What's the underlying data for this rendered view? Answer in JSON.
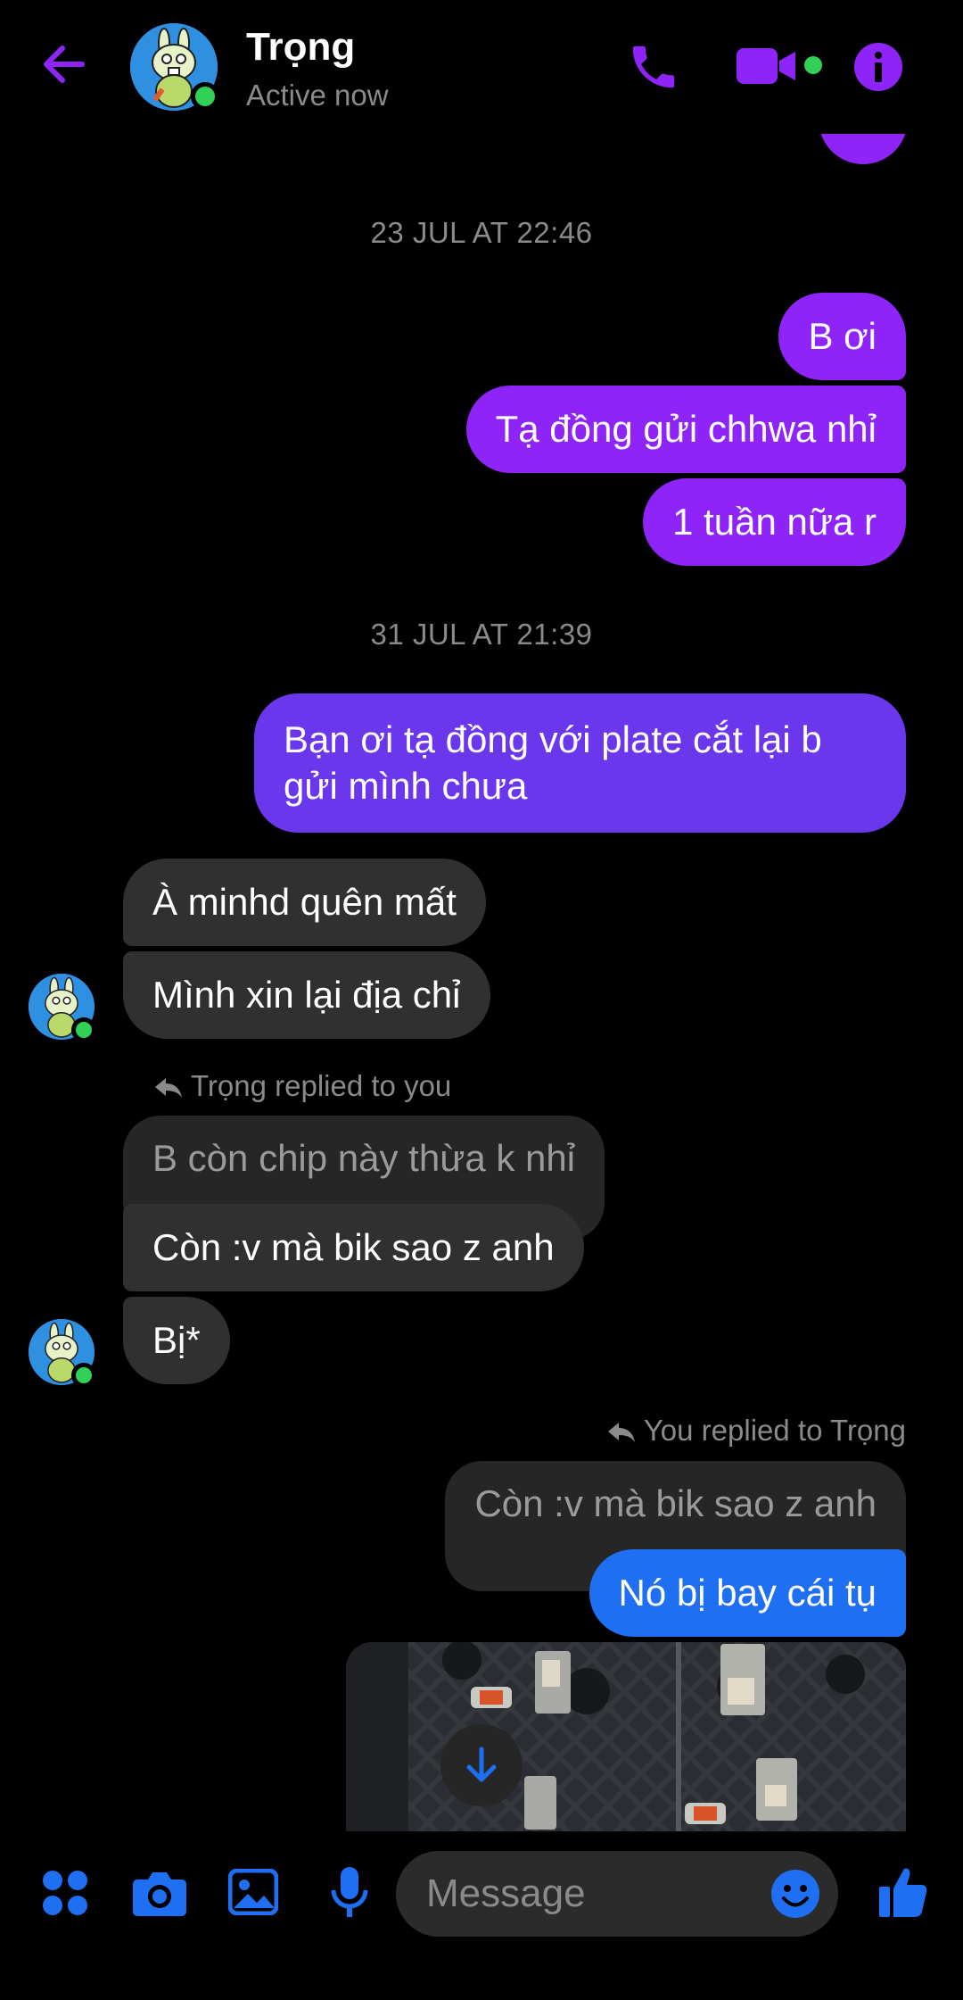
{
  "header": {
    "contact_name": "Trọng",
    "contact_status": "Active now",
    "accent_color": "#8e24f7",
    "online_color": "#31d158",
    "icons": [
      "back-arrow-icon",
      "phone-icon",
      "video-camera-icon",
      "info-icon"
    ]
  },
  "conversation": {
    "timestamps": [
      "23 JUL AT 22:46",
      "31 JUL AT 21:39"
    ],
    "messages": [
      {
        "sender": "you",
        "text": "B ơi"
      },
      {
        "sender": "you",
        "text": "Tạ đồng gửi chhwa nhỉ"
      },
      {
        "sender": "you",
        "text": "1 tuần nữa r"
      },
      {
        "sender": "you",
        "text_line1": "Bạn ơi tạ đồng với plate cắt lại b",
        "text_line2": "gửi mình chưa"
      },
      {
        "sender": "Trọng",
        "text": "À minhd quên mất"
      },
      {
        "sender": "Trọng",
        "text": "Mình xin lại địa chỉ"
      },
      {
        "sender": "Trọng",
        "reply_note": "Trọng replied to you",
        "quoted": "B còn chip này thừa k nhỉ",
        "text": "Còn :v mà bik sao z anh"
      },
      {
        "sender": "Trọng",
        "text": "Bị*"
      },
      {
        "sender": "you",
        "reply_note": "You replied to Trọng",
        "quoted": "Còn :v mà bik sao z anh",
        "text": "Nó bị bay cái tụ"
      }
    ],
    "attachment": "photo"
  },
  "composer": {
    "placeholder": "Message",
    "icons": [
      "apps-icon",
      "camera-icon",
      "gallery-icon",
      "microphone-icon",
      "emoji-icon",
      "thumbs-up-icon"
    ],
    "icon_color": "#1f6ff2"
  }
}
